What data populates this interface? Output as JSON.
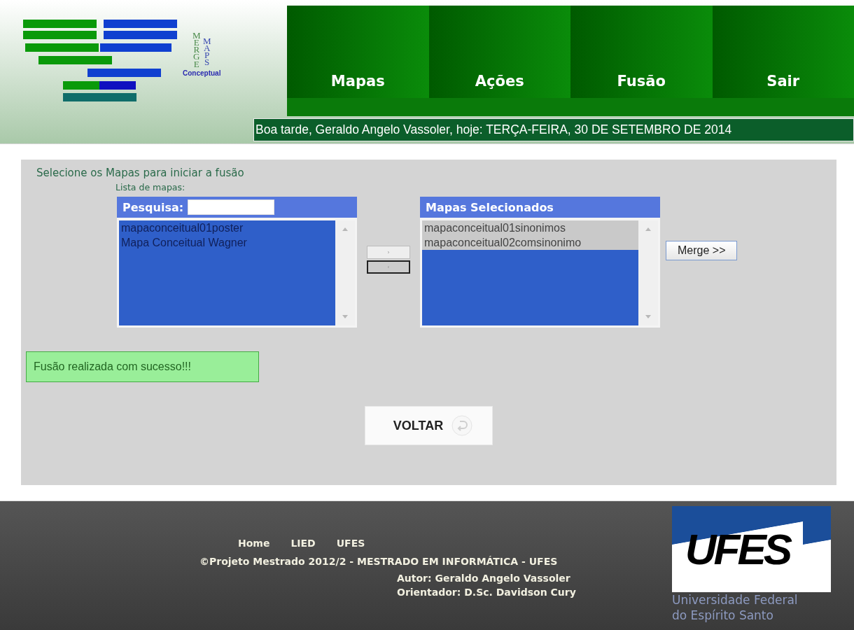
{
  "logo": {
    "word_1": "MERGE",
    "word_2": "MAPS",
    "subtitle": "Conceptual"
  },
  "nav": [
    {
      "label": "Mapas"
    },
    {
      "label": "Ações"
    },
    {
      "label": "Fusão"
    },
    {
      "label": "Sair"
    }
  ],
  "greeting": "Boa tarde, Geraldo Angelo Vassoler, hoje: TERÇA-FEIRA, 30 DE SETEMBRO DE 2014",
  "panel": {
    "title": "Selecione os Mapas para iniciar a fusão",
    "list_label": "Lista de mapas:",
    "source": {
      "search_label": "Pesquisa:",
      "items": [
        {
          "label": "mapaconceitual01poster",
          "selected": false
        },
        {
          "label": "Mapa Conceitual Wagner",
          "selected": false
        }
      ]
    },
    "move_buttons": [
      {
        "label": "›"
      },
      {
        "label": "‹"
      }
    ],
    "target": {
      "title": "Mapas Selecionados",
      "items": [
        {
          "label": "mapaconceitual01sinonimos",
          "selected": true
        },
        {
          "label": "mapaconceitual02comsinonimo",
          "selected": true
        }
      ]
    },
    "merge_button": "Merge >>",
    "message": "Fusão realizada com sucesso!!!",
    "back_button": "VOLTAR"
  },
  "footer": {
    "links": [
      "Home",
      "LIED",
      "UFES"
    ],
    "copyright": "©Projeto Mestrado 2012/2 - MESTRADO EM INFORMÁTICA - UFES",
    "author": "Autor: Geraldo Angelo Vassoler",
    "advisor": "Orientador: D.Sc. Davidson Cury",
    "ufes_logo": {
      "mark": "UFES",
      "line_1": "Universidade Federal",
      "line_2": "do Espírito Santo"
    }
  }
}
